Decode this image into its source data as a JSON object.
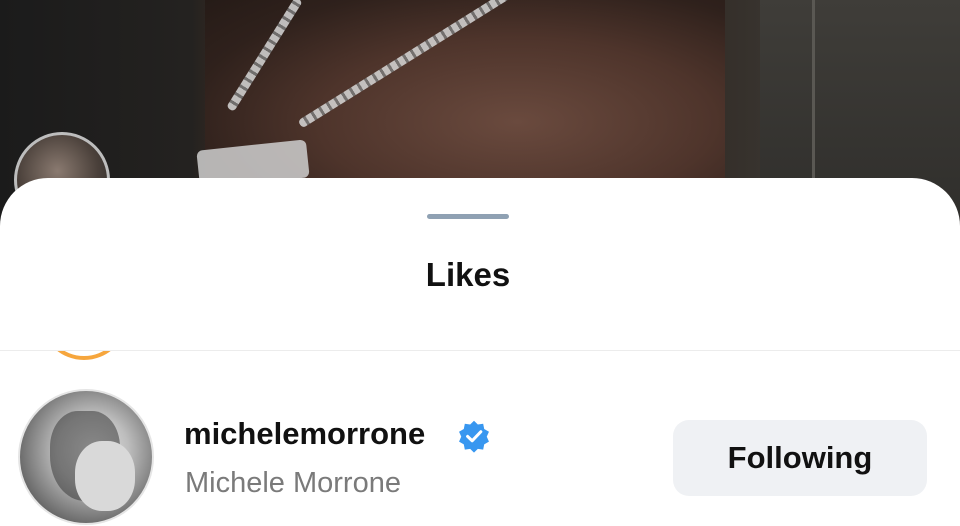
{
  "sheet": {
    "title": "Likes"
  },
  "likes_list": [
    {
      "username": "michelemorrone",
      "full_name": "Michele Morrone",
      "verified": true,
      "action_label": "Following"
    }
  ],
  "colors": {
    "verified_badge": "#3897f0",
    "story_ring": "#f6a63d",
    "button_bg": "#eff1f4",
    "secondary_text": "#7a7a7a"
  }
}
